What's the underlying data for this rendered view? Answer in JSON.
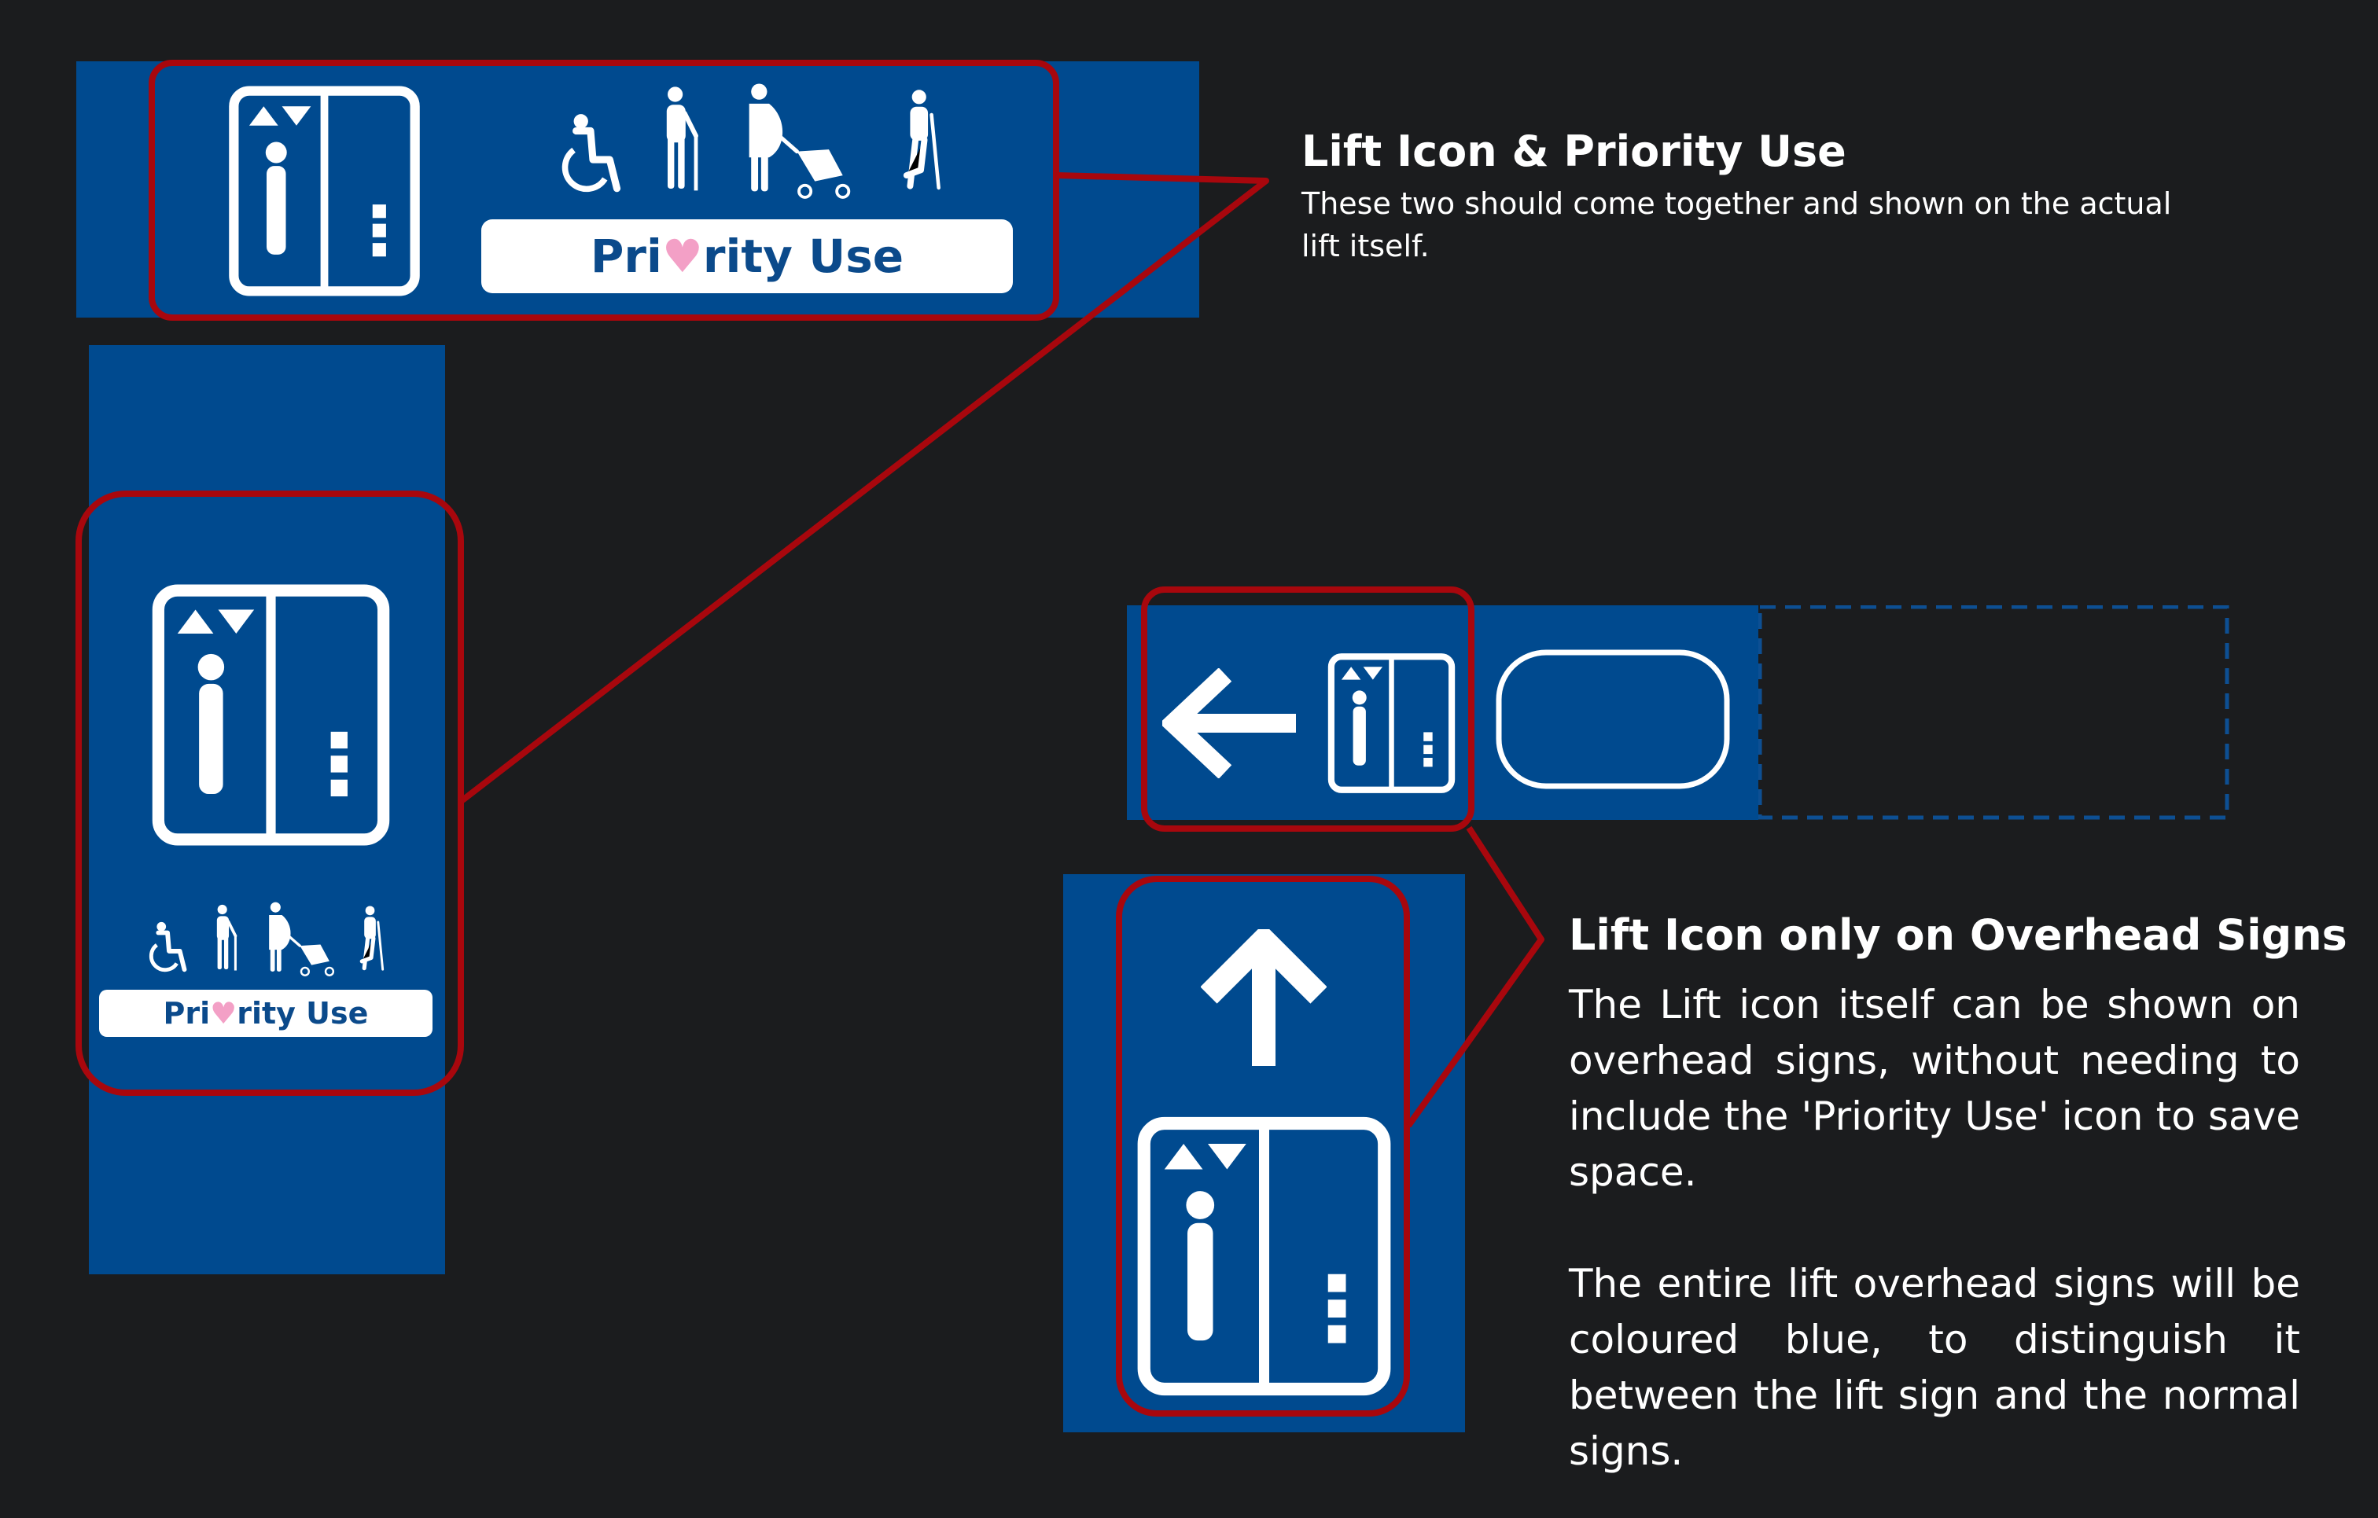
{
  "colors": {
    "background": "#1b1c1e",
    "sign_blue": "#004a8f",
    "callout_red": "#a8070d",
    "heart_pink": "#f3a0c6",
    "text_white": "#ffffff"
  },
  "section_priority": {
    "heading": "Lift Icon & Priority Use",
    "body": "These two should come together and shown on the actual lift itself."
  },
  "section_overhead": {
    "heading": "Lift Icon only on Overhead Signs",
    "paragraph1": "The Lift icon itself can be shown on overhead signs, without needing to include the 'Priority Use' icon to save space.",
    "paragraph2": "The entire lift overhead signs will be coloured blue, to distinguish it between the lift sign and the normal signs."
  },
  "priority_label": {
    "part1": "Pri",
    "heart": "♥",
    "part2": "rity Use"
  },
  "icons": {
    "lift": "lift-icon",
    "wheelchair": "wheelchair-user-icon",
    "elderly": "elderly-person-icon",
    "pregnant_stroller": "pregnant-woman-with-stroller-icon",
    "crutch": "person-with-crutch-icon",
    "arrow_left": "arrow-left-icon",
    "arrow_up": "arrow-up-icon",
    "empty_placeholder": "rounded-rectangle-placeholder"
  }
}
